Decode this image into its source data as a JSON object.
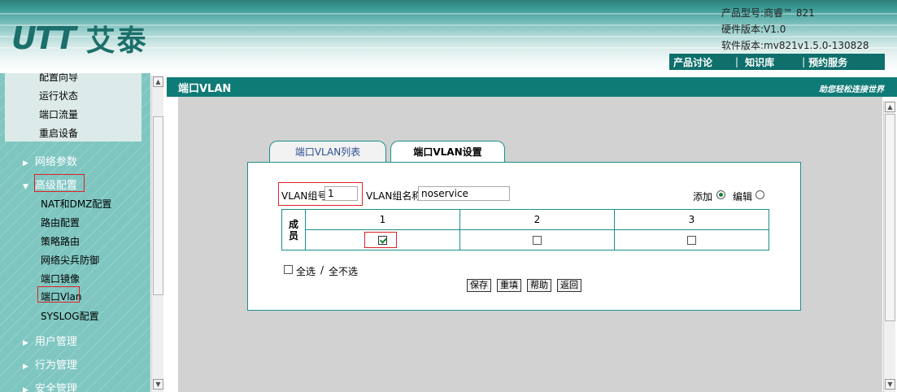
{
  "header": {
    "logo_mark": "UTT",
    "logo_cn": "艾泰",
    "product_model": "产品型号:商睿™ 821",
    "hardware_version": "硬件版本:V1.0",
    "software_version": "软件版本:mv821v1.5.0-130828",
    "links": [
      "产品讨论",
      "知识库",
      "预约服务"
    ],
    "colors": {
      "teal_dark": "#0e6f6b",
      "teal_mid": "#3a9a95"
    }
  },
  "sidebar": {
    "top_items": [
      "配置向导",
      "运行状态",
      "端口流量",
      "重启设备"
    ],
    "groups": [
      {
        "label": "网络参数",
        "expanded": false
      },
      {
        "label": "高级配置",
        "expanded": true
      },
      {
        "label": "用户管理",
        "expanded": false
      },
      {
        "label": "行为管理",
        "expanded": false
      },
      {
        "label": "安全管理",
        "expanded": false
      }
    ],
    "advanced_items": [
      "NAT和DMZ配置",
      "路由配置",
      "策略路由",
      "网络尖兵防御",
      "端口镜像",
      "端口Vlan",
      "SYSLOG配置"
    ],
    "active_group": "高级配置",
    "active_item": "端口Vlan"
  },
  "page": {
    "title": "端口VLAN",
    "slogan": "助您轻松连接世界",
    "tabs": [
      "端口VLAN列表",
      "端口VLAN设置"
    ],
    "active_tab": "端口VLAN设置"
  },
  "form": {
    "vlan_id_label": "VLAN组号",
    "vlan_id_value": "1",
    "vlan_name_label": "VLAN组名称",
    "vlan_name_value": "noservice",
    "mode_add_label": "添加",
    "mode_edit_label": "编辑",
    "mode_selected": "添加",
    "members_label": "成员",
    "ports": [
      {
        "number": "1",
        "checked": true
      },
      {
        "number": "2",
        "checked": false
      },
      {
        "number": "3",
        "checked": false
      }
    ],
    "select_all_label": "全选",
    "deselect_all_label": "全不选",
    "separator": "/"
  },
  "buttons": {
    "save": "保存",
    "reset": "重填",
    "help": "帮助",
    "back": "返回"
  }
}
